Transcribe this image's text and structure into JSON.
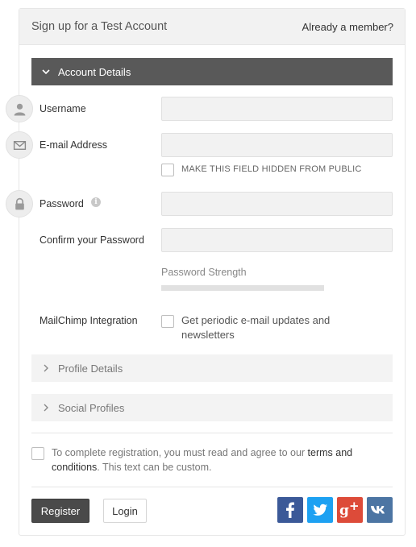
{
  "header": {
    "title": "Sign up for a Test Account",
    "member_link": "Already a member?"
  },
  "sections": {
    "account": {
      "label": "Account Details"
    },
    "profile": {
      "label": "Profile Details"
    },
    "social": {
      "label": "Social Profiles"
    }
  },
  "fields": {
    "username": {
      "label": "Username",
      "value": "",
      "placeholder": ""
    },
    "email": {
      "label": "E-mail Address",
      "value": "",
      "placeholder": ""
    },
    "hide_email": {
      "label": "MAKE THIS FIELD HIDDEN FROM PUBLIC"
    },
    "password": {
      "label": "Password",
      "value": "",
      "placeholder": "",
      "info_icon": "info-icon"
    },
    "confirm_password": {
      "label": "Confirm your Password",
      "value": "",
      "placeholder": ""
    }
  },
  "password_strength": {
    "label": "Password Strength",
    "level": 0
  },
  "mailchimp": {
    "label": "MailChimp Integration",
    "option": "Get periodic e-mail updates and newsletters"
  },
  "terms": {
    "before": "To complete registration, you must read and agree to our ",
    "link": "terms and conditions",
    "after": ". This text can be custom."
  },
  "buttons": {
    "register": "Register",
    "login": "Login"
  },
  "social": {
    "icons": [
      "facebook-icon",
      "twitter-icon",
      "google-plus-icon",
      "vk-icon"
    ]
  },
  "colors": {
    "accent": "#595959",
    "facebook": "#3b5998",
    "twitter": "#1da1f2",
    "google_plus": "#dd4b39",
    "vk": "#4c75a3"
  }
}
